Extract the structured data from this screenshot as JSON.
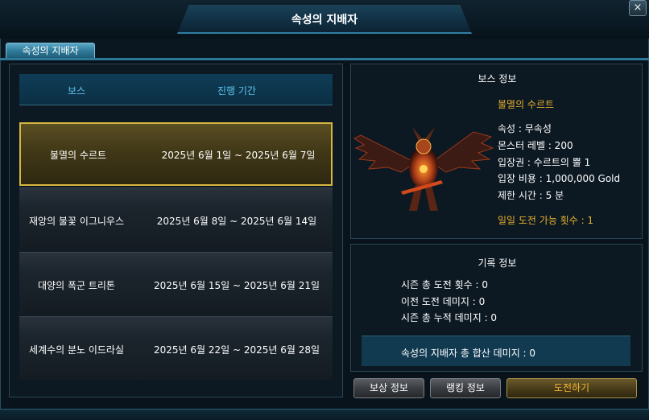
{
  "window": {
    "title": "속성의 지배자",
    "close_label": "×"
  },
  "tab": {
    "label": "속성의 지배자"
  },
  "list": {
    "header_boss": "보스",
    "header_period": "진행 기간",
    "rows": [
      {
        "name": "불멸의 수르트",
        "period": "2025년 6월 1일 ~ 2025년 6월 7일",
        "selected": true
      },
      {
        "name": "재앙의 불꽃 이그니우스",
        "period": "2025년 6월 8일 ~ 2025년 6월 14일",
        "selected": false
      },
      {
        "name": "대양의 폭군 트리톤",
        "period": "2025년 6월 15일 ~ 2025년 6월 21일",
        "selected": false
      },
      {
        "name": "세계수의 분노 이드라실",
        "period": "2025년 6월 22일 ~ 2025년 6월 28일",
        "selected": false
      }
    ]
  },
  "boss_info": {
    "title": "보스 정보",
    "name": "불멸의 수르트",
    "stats": [
      "속성 : 무속성",
      "몬스터 레벨 : 200",
      "입장권 : 수르트의 뿔 1",
      "입장 비용 : 1,000,000 Gold",
      "제한 시간 : 5 분"
    ],
    "daily_attempts": "일일 도전 가능 횟수 : 1"
  },
  "record_info": {
    "title": "기록 정보",
    "lines": [
      "시즌 총 도전 횟수 : 0",
      "이전 도전 데미지 : 0",
      "시즌 총 누적 데미지 : 0"
    ],
    "total": "속성의 지배자 총 합산 데미지 : 0"
  },
  "buttons": {
    "reward": "보상 정보",
    "ranking": "랭킹 정보",
    "challenge": "도전하기"
  },
  "colors": {
    "accent_blue": "#5fc3ee",
    "gold_text": "#e5b02e",
    "selected_border": "#d7b640"
  }
}
